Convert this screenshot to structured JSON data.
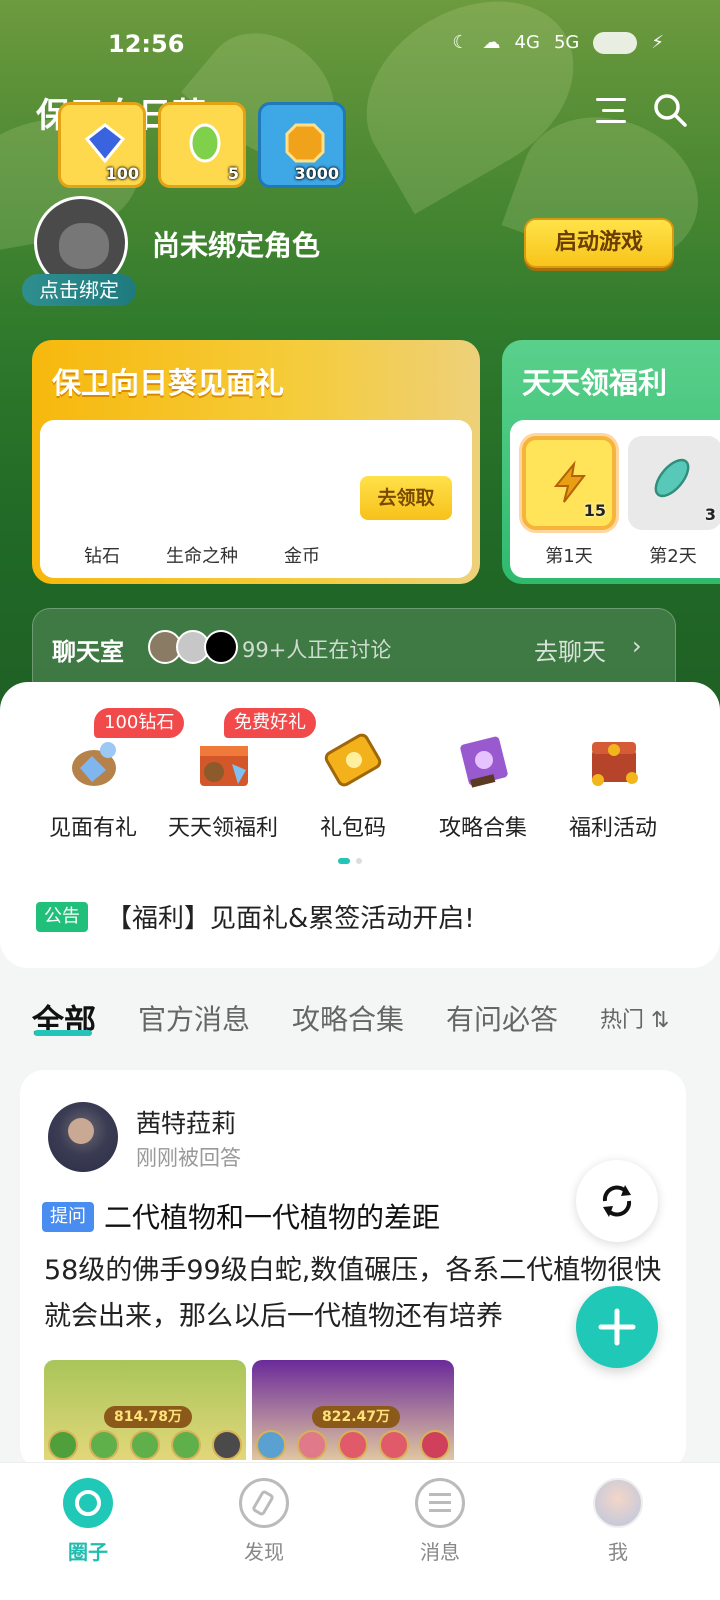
{
  "status_bar": {
    "time": "12:56",
    "signal_1": "4G",
    "signal_2": "5G",
    "battery": "99"
  },
  "header": {
    "title": "保卫向日葵"
  },
  "profile": {
    "unbound_text": "尚未绑定角色",
    "bind_label": "点击绑定",
    "start_game_label": "启动游戏"
  },
  "gift_card": {
    "title": "保卫向日葵见面礼",
    "claim_label": "去领取",
    "rewards": [
      {
        "label": "钻石",
        "qty": "100",
        "icon": "diamond-icon"
      },
      {
        "label": "生命之种",
        "qty": "5",
        "icon": "life-seed-icon"
      },
      {
        "label": "金币",
        "qty": "3000",
        "icon": "gold-coin-icon"
      }
    ]
  },
  "daily_card": {
    "title": "天天领福利",
    "days": [
      {
        "label": "第1天",
        "qty": "15",
        "icon": "lightning-icon"
      },
      {
        "label": "第2天",
        "qty": "3",
        "icon": "feather-icon"
      }
    ]
  },
  "chat": {
    "title": "聊天室",
    "count_text": "99+人正在讨论",
    "go_label": "去聊天",
    "chevron": "›"
  },
  "quick_links": [
    {
      "label": "见面有礼",
      "badge": "100钻石",
      "icon": "gift-bag-icon"
    },
    {
      "label": "天天领福利",
      "badge": "免费好礼",
      "icon": "gift-box-icon"
    },
    {
      "label": "礼包码",
      "badge": "",
      "icon": "ticket-icon"
    },
    {
      "label": "攻略合集",
      "badge": "",
      "icon": "book-icon"
    },
    {
      "label": "福利活动",
      "badge": "",
      "icon": "treasure-chest-icon"
    }
  ],
  "notice": {
    "tag": "公告",
    "text": "【福利】见面礼&累签活动开启!"
  },
  "tabs": [
    "全部",
    "官方消息",
    "攻略合集",
    "有问必答"
  ],
  "sort_label": "热门",
  "post": {
    "user": "茜特菈莉",
    "sub": "刚刚被回答",
    "tag": "提问",
    "title": "二代植物和一代植物的差距",
    "body": "58级的佛手99级白蛇,数值碾压，各系二代植物很快就会出来，那么以后一代植物还有培养",
    "thumb_scores": [
      "814.78万",
      "822.47万"
    ]
  },
  "bottom_nav": [
    {
      "label": "圈子",
      "icon": "circle-icon",
      "active": true
    },
    {
      "label": "发现",
      "icon": "compass-icon",
      "active": false
    },
    {
      "label": "消息",
      "icon": "message-icon",
      "active": false
    },
    {
      "label": "我",
      "icon": "profile-avatar-icon",
      "active": false
    }
  ],
  "colors": {
    "accent": "#1fc8b7",
    "hero_green": "#2f7a2c",
    "gold": "#f7c11a",
    "badge_red": "#f2494a",
    "notice_green": "#20c07a",
    "question_blue": "#4a8df0"
  }
}
